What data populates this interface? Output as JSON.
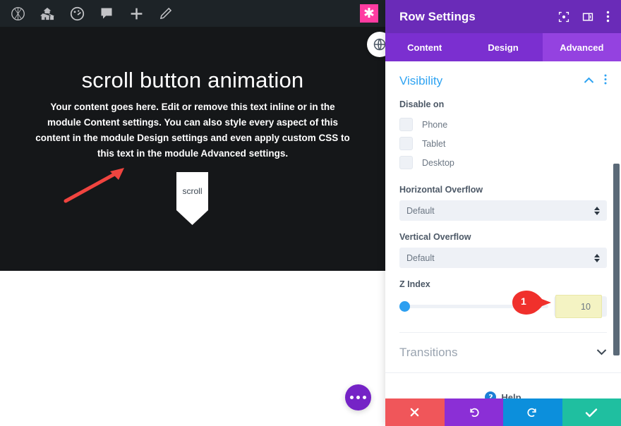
{
  "admin_bar": {
    "icons": [
      {
        "name": "wordpress-logo-icon"
      },
      {
        "name": "site-home-icon"
      },
      {
        "name": "dashboard-gauge-icon"
      },
      {
        "name": "comments-bubble-icon"
      },
      {
        "name": "new-content-plus-icon"
      },
      {
        "name": "edit-pencil-icon"
      }
    ],
    "right_badge": {
      "name": "asterisk-badge-icon",
      "glyph": "✱",
      "color": "#ff3ca1"
    }
  },
  "preview": {
    "heading": "scroll button animation",
    "body": "Your content goes here. Edit or remove this text inline or in the module Content settings. You can also style every aspect of this content in the module Design settings and even apply custom CSS to this text in the module Advanced settings.",
    "scroll_button_label": "scroll",
    "background": "#151719",
    "annotation_arrow_color": "#f0443f"
  },
  "panel": {
    "title": "Row Settings",
    "header_color": "#6a2bb8",
    "header_icons": [
      {
        "name": "focus-target-icon"
      },
      {
        "name": "panel-layout-icon"
      },
      {
        "name": "kebab-menu-icon"
      }
    ],
    "tabs": [
      {
        "label": "Content",
        "active": false
      },
      {
        "label": "Design",
        "active": false
      },
      {
        "label": "Advanced",
        "active": true
      }
    ],
    "visibility": {
      "title": "Visibility",
      "title_color": "#2ea3f2",
      "collapse_icon": "chevron-up-icon",
      "menu_icon": "kebab-menu-icon",
      "disable_on_label": "Disable on",
      "options": [
        {
          "label": "Phone",
          "checked": false
        },
        {
          "label": "Tablet",
          "checked": false
        },
        {
          "label": "Desktop",
          "checked": false
        }
      ],
      "horizontal_overflow": {
        "label": "Horizontal Overflow",
        "value": "Default"
      },
      "vertical_overflow": {
        "label": "Vertical Overflow",
        "value": "Default"
      },
      "z_index": {
        "label": "Z Index",
        "value": "10",
        "slider_position_percent": 0,
        "highlight_color": "#f4f3c3",
        "callout": {
          "number": "1",
          "color": "#f0302c"
        }
      }
    },
    "transitions": {
      "title": "Transitions",
      "expand_icon": "chevron-down-icon"
    },
    "help": {
      "label": "Help",
      "icon": "help-question-icon"
    },
    "actions": [
      {
        "name": "cancel",
        "icon": "close-x-icon",
        "color": "#f0565a"
      },
      {
        "name": "undo",
        "icon": "undo-arrow-icon",
        "color": "#8b2fd6"
      },
      {
        "name": "redo",
        "icon": "redo-arrow-icon",
        "color": "#0c8fdc"
      },
      {
        "name": "save",
        "icon": "checkmark-icon",
        "color": "#1fbfa0"
      }
    ]
  },
  "floating": {
    "settings_fab": {
      "name": "ellipsis-fab",
      "color": "#7523c6"
    },
    "preview_toggle": {
      "name": "preview-toggle-icon"
    }
  }
}
